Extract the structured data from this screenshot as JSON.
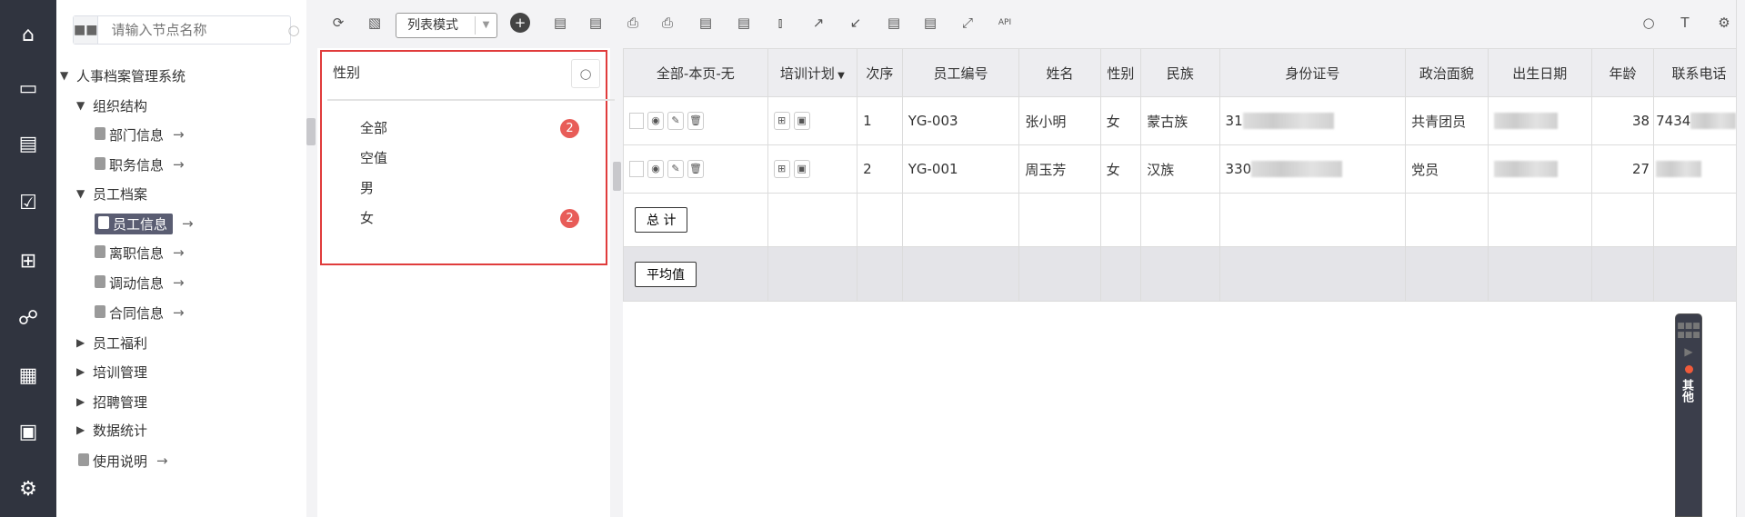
{
  "nav": {
    "icons": [
      "home-icon",
      "monitor-play-icon",
      "clipboard-list-icon",
      "form-check-icon",
      "org-tree-icon",
      "share-icon",
      "presentation-chart-icon",
      "screen-settings-icon",
      "gear-icon"
    ]
  },
  "tree": {
    "search_placeholder": "请输入节点名称",
    "items": [
      {
        "label": "人事档案管理系统",
        "level": 0,
        "type": "expanded"
      },
      {
        "label": "组织结构",
        "level": 1,
        "type": "expanded"
      },
      {
        "label": "部门信息",
        "level": 2,
        "type": "doc"
      },
      {
        "label": "职务信息",
        "level": 2,
        "type": "doc"
      },
      {
        "label": "员工档案",
        "level": 1,
        "type": "expanded"
      },
      {
        "label": "员工信息",
        "level": 2,
        "type": "doc",
        "selected": true
      },
      {
        "label": "离职信息",
        "level": 2,
        "type": "doc"
      },
      {
        "label": "调动信息",
        "level": 2,
        "type": "doc"
      },
      {
        "label": "合同信息",
        "level": 2,
        "type": "doc"
      },
      {
        "label": "员工福利",
        "level": 1,
        "type": "collapsed"
      },
      {
        "label": "培训管理",
        "level": 1,
        "type": "collapsed"
      },
      {
        "label": "招聘管理",
        "level": 1,
        "type": "collapsed"
      },
      {
        "label": "数据统计",
        "level": 1,
        "type": "collapsed"
      },
      {
        "label": "使用说明",
        "level": 0,
        "type": "doc"
      }
    ]
  },
  "toolbar": {
    "mode": "列表模式"
  },
  "filter": {
    "field": "性别",
    "options": [
      {
        "label": "全部",
        "count": "2"
      },
      {
        "label": "空值",
        "count": ""
      },
      {
        "label": "男",
        "count": ""
      },
      {
        "label": "女",
        "count": "2"
      }
    ]
  },
  "table": {
    "columns": [
      "全部-本页-无",
      "培训计划",
      "次序",
      "员工编号",
      "姓名",
      "性别",
      "民族",
      "身份证号",
      "政治面貌",
      "出生日期",
      "年龄",
      "联系电话"
    ],
    "rows": [
      {
        "seq": "1",
        "id": "YG-003",
        "name": "张小明",
        "gender": "女",
        "ethnic": "蒙古族",
        "idcard": "31",
        "political": "共青团员",
        "age": "38",
        "phone": "7434"
      },
      {
        "seq": "2",
        "id": "YG-001",
        "name": "周玉芳",
        "gender": "女",
        "ethnic": "汉族",
        "idcard": "330",
        "political": "党员",
        "age": "27",
        "phone": ""
      }
    ],
    "total_label": "总 计",
    "avg_label": "平均值"
  },
  "float": {
    "label": "其他"
  },
  "colors": {
    "nav_bg": "#30343f",
    "badge": "#e85c58",
    "highlight_border": "#e03c3c",
    "selected_item": "#5a5d72"
  }
}
